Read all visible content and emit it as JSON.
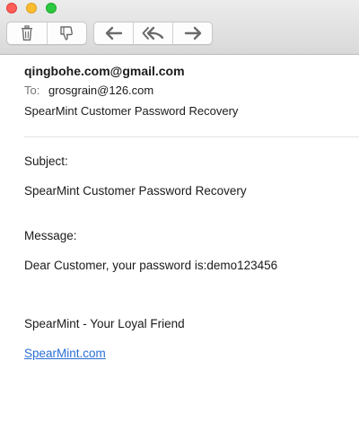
{
  "window": {
    "traffic_lights": [
      "close",
      "minimize",
      "zoom"
    ]
  },
  "toolbar": {
    "icons": [
      "trash-icon",
      "junk-icon",
      "reply-icon",
      "reply-all-icon",
      "forward-icon"
    ]
  },
  "header": {
    "from": "qingbohe.com@gmail.com",
    "to_label": "To:",
    "to_value": "grosgrain@126.com",
    "subject": "SpearMint Customer Password Recovery"
  },
  "body": {
    "subject_label": "Subject:",
    "subject_value": "SpearMint Customer Password Recovery",
    "message_label": "Message:",
    "message_value": "Dear Customer, your password is:demo123456",
    "signature": "SpearMint - Your Loyal Friend",
    "link": "SpearMint.com"
  },
  "colors": {
    "link": "#2a6fd6",
    "close": "#fd5c57",
    "minimize": "#fdbc2f",
    "zoom": "#2bc840"
  }
}
